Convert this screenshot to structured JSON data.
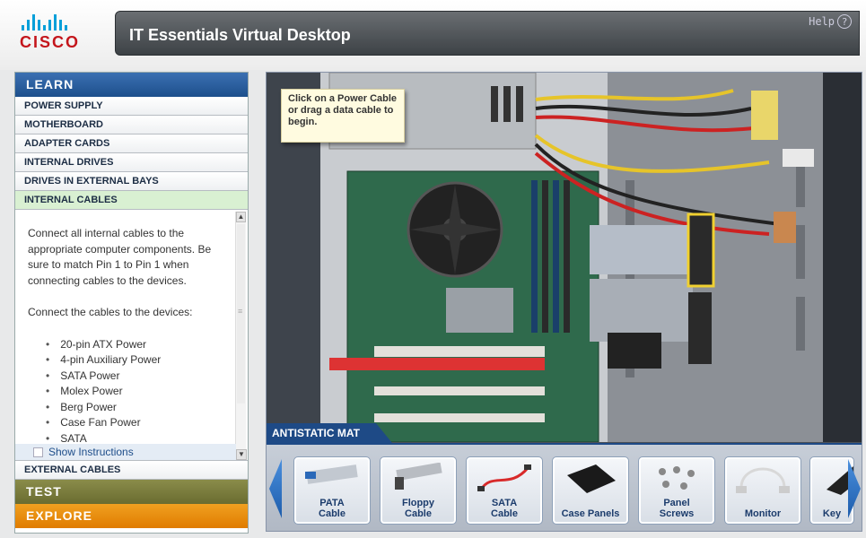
{
  "header": {
    "brand": "CISCO",
    "title": "IT Essentials Virtual Desktop",
    "help_label": "Help",
    "help_icon": "?"
  },
  "sidebar": {
    "learn_label": "LEARN",
    "items": [
      {
        "label": "POWER SUPPLY"
      },
      {
        "label": "MOTHERBOARD"
      },
      {
        "label": "ADAPTER CARDS"
      },
      {
        "label": "INTERNAL DRIVES"
      },
      {
        "label": "DRIVES IN EXTERNAL BAYS"
      },
      {
        "label": "INTERNAL CABLES"
      }
    ],
    "instructions": {
      "para1": "Connect all internal cables to the appropriate computer components. Be sure to match Pin 1 to Pin 1 when connecting cables to the devices.",
      "para2": "Connect the cables to the devices:",
      "bullets": [
        "20-pin ATX Power",
        "4-pin Auxiliary Power",
        "SATA Power",
        "Molex Power",
        "Berg Power",
        "Case Fan Power",
        "SATA"
      ],
      "show_instructions": "Show Instructions"
    },
    "external_cables": "EXTERNAL CABLES",
    "test_label": "TEST",
    "explore_label": "EXPLORE"
  },
  "workspace": {
    "tooltip": "Click on a Power Cable or drag a data cable to begin.",
    "mat_label": "ANTISTATIC MAT",
    "tray": [
      {
        "label": "PATA\nCable",
        "icon": "pata-cable"
      },
      {
        "label": "Floppy\nCable",
        "icon": "floppy-cable"
      },
      {
        "label": "SATA\nCable",
        "icon": "sata-cable"
      },
      {
        "label": "Case Panels",
        "icon": "case-panel"
      },
      {
        "label": "Panel\nScrews",
        "icon": "screws"
      },
      {
        "label": "Monitor",
        "icon": "monitor-cable"
      },
      {
        "label": "Key",
        "icon": "keyboard"
      }
    ]
  },
  "colors": {
    "learn_blue": "#1d4f8c",
    "test_olive": "#6a6c30",
    "explore_orange": "#e07c00",
    "active_green": "#d9f0d2"
  }
}
